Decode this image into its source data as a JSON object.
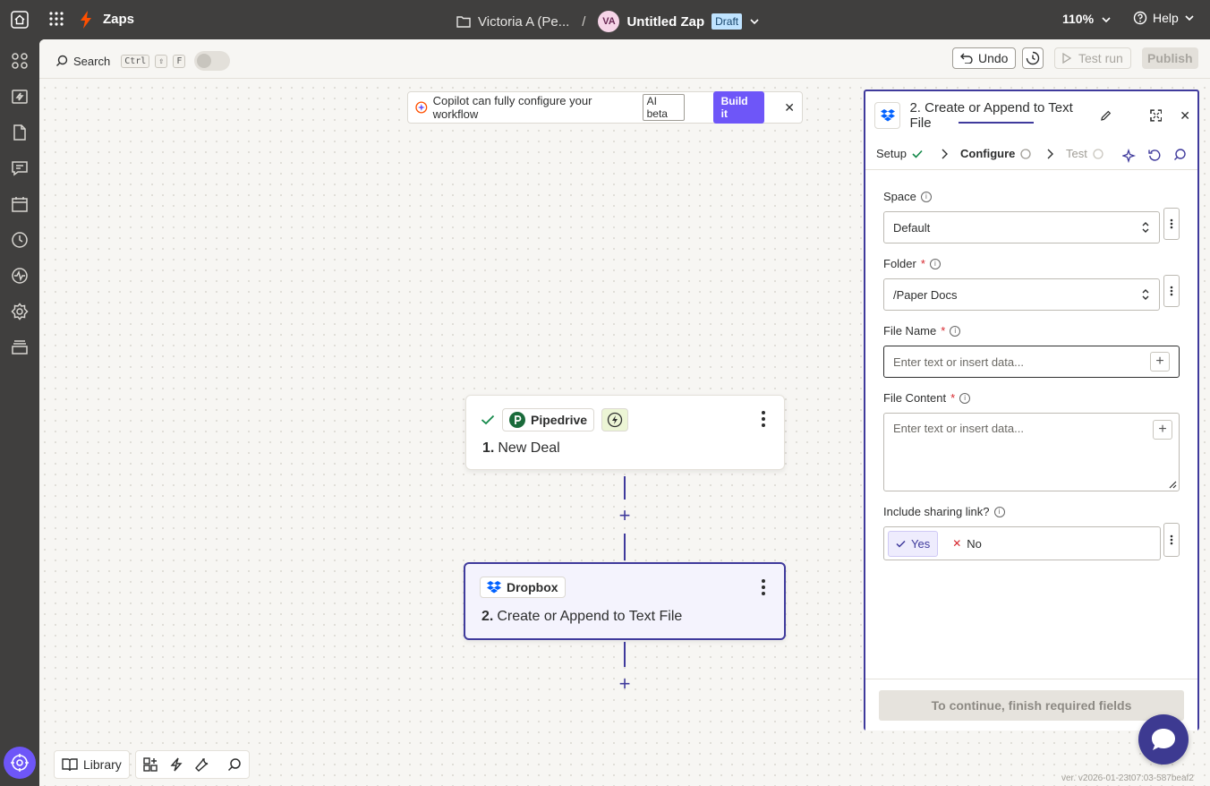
{
  "topbar": {
    "app_name": "Zaps",
    "folder": "Victoria A (Pe...",
    "separator": "/",
    "avatar_initials": "VA",
    "zap_name": "Untitled Zap",
    "status": "Draft",
    "zoom": "110%",
    "help": "Help"
  },
  "toolbar": {
    "search_label": "Search",
    "shortcut_keys": [
      "Ctrl",
      "⇧",
      "F"
    ],
    "undo": "Undo",
    "test_run": "Test run",
    "publish": "Publish"
  },
  "copilot": {
    "text": "Copilot can fully configure your workflow",
    "badge": "AI beta",
    "button": "Build it"
  },
  "steps": [
    {
      "app": "Pipedrive",
      "number": "1.",
      "title": "New Deal"
    },
    {
      "app": "Dropbox",
      "number": "2.",
      "title": "Create or Append to Text File"
    }
  ],
  "panel": {
    "title": "2. Create or Append to Text File",
    "tabs": {
      "setup": "Setup",
      "configure": "Configure",
      "test": "Test"
    },
    "fields": {
      "space": {
        "label": "Space",
        "value": "Default"
      },
      "folder": {
        "label": "Folder",
        "value": "/Paper Docs",
        "required": "*"
      },
      "file_name": {
        "label": "File Name",
        "placeholder": "Enter text or insert data...",
        "required": "*"
      },
      "file_content": {
        "label": "File Content",
        "placeholder": "Enter text or insert data...",
        "required": "*"
      },
      "sharing": {
        "label": "Include sharing link?",
        "yes": "Yes",
        "no": "No"
      }
    },
    "continue_button": "To continue, finish required fields"
  },
  "bottom": {
    "library": "Library"
  },
  "version": "ver. v2026-01-23t07:03-587beaf2",
  "colors": {
    "accent": "#3f3a9c",
    "brand": "#6e56f8",
    "zapier_orange": "#ff4f00",
    "topbar": "#403f3e"
  }
}
